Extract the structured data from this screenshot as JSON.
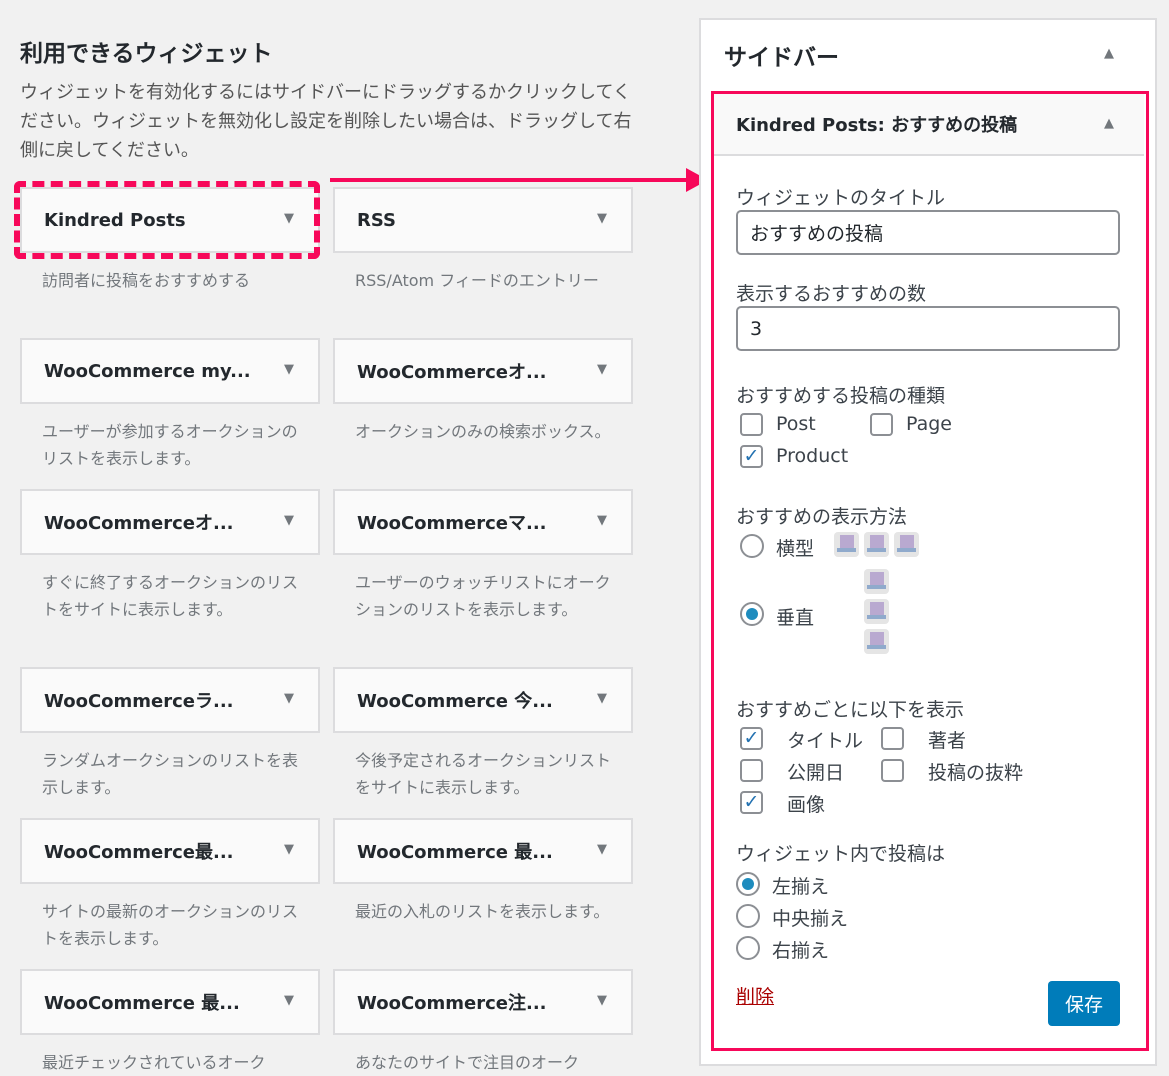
{
  "available": {
    "title": "利用できるウィジェット",
    "intro": "ウィジェットを有効化するにはサイドバーにドラッグするかクリックしてください。ウィジェットを無効化し設定を削除したい場合は、ドラッグして右側に戻してください。",
    "widgets": [
      {
        "name": "Kindred Posts",
        "desc": "訪問者に投稿をおすすめする"
      },
      {
        "name": "RSS",
        "desc": "RSS/Atom フィードのエントリー"
      },
      {
        "name": "WooCommerce my...",
        "desc": "ユーザーが参加するオークションのリストを表示します。"
      },
      {
        "name": "WooCommerceオ...",
        "desc": "オークションのみの検索ボックス。"
      },
      {
        "name": "WooCommerceオ...",
        "desc": "すぐに終了するオークションのリストをサイトに表示します。"
      },
      {
        "name": "WooCommerceマ...",
        "desc": "ユーザーのウォッチリストにオークションのリストを表示します。"
      },
      {
        "name": "WooCommerceラ...",
        "desc": "ランダムオークションのリストを表示します。"
      },
      {
        "name": "WooCommerce 今...",
        "desc": "今後予定されるオークションリストをサイトに表示します。"
      },
      {
        "name": "WooCommerce最...",
        "desc": "サイトの最新のオークションのリストを表示します。"
      },
      {
        "name": "WooCommerce 最...",
        "desc": "最近の入札のリストを表示します。"
      },
      {
        "name": "WooCommerce 最...",
        "desc": "最近チェックされているオーク"
      },
      {
        "name": "WooCommerce注...",
        "desc": "あなたのサイトで注目のオーク"
      }
    ]
  },
  "sidebar": {
    "title": "サイドバー",
    "widget_title": "Kindred Posts: おすすめの投稿",
    "form": {
      "title_label": "ウィジェットのタイトル",
      "title_value": "おすすめの投稿",
      "count_label": "表示するおすすめの数",
      "count_value": "3",
      "types_label": "おすすめする投稿の種類",
      "types": [
        {
          "label": "Post",
          "checked": false
        },
        {
          "label": "Page",
          "checked": false
        },
        {
          "label": "Product",
          "checked": true
        }
      ],
      "display_label": "おすすめの表示方法",
      "display": [
        {
          "label": "横型",
          "selected": false
        },
        {
          "label": "垂直",
          "selected": true
        }
      ],
      "show_label": "おすすめごとに以下を表示",
      "show": [
        {
          "label": "タイトル",
          "checked": true
        },
        {
          "label": "著者",
          "checked": false
        },
        {
          "label": "公開日",
          "checked": false
        },
        {
          "label": "投稿の抜粋",
          "checked": false
        },
        {
          "label": "画像",
          "checked": true
        }
      ],
      "align_label": "ウィジェット内で投稿は",
      "align": [
        {
          "label": "左揃え",
          "selected": true
        },
        {
          "label": "中央揃え",
          "selected": false
        },
        {
          "label": "右揃え",
          "selected": false
        }
      ],
      "delete_label": "削除",
      "save_label": "保存"
    }
  },
  "colors": {
    "highlight": "#f7085a",
    "primary_button": "#007cba",
    "radio_selected": "#1e8cbe",
    "delete_link": "#aa0000"
  },
  "icons": {
    "widget_toggle": "triangle-down-icon",
    "panel_toggle": "triangle-up-icon"
  }
}
